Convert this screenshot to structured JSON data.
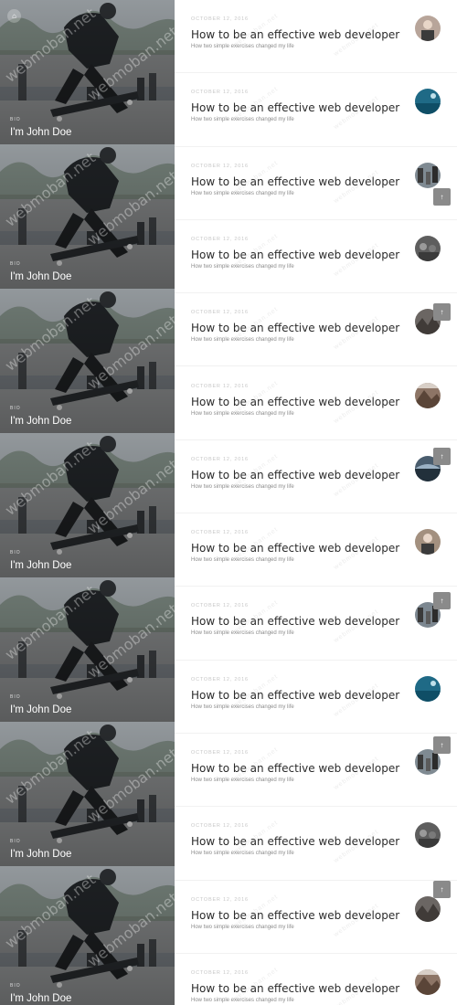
{
  "profile": {
    "bio_label": "BIO",
    "name": "I'm John Doe",
    "watermark": "webmoban.net",
    "home_icon": "home-icon"
  },
  "posts": [
    {
      "date": "OCTOBER 12, 2016",
      "title": "How to be an effective web developer",
      "excerpt": "How two simple exercises changed my life",
      "thumb": "person-photo",
      "thumb_color": "#b8a59a"
    },
    {
      "date": "OCTOBER 12, 2016",
      "title": "How to be an effective web developer",
      "excerpt": "How two simple exercises changed my life",
      "thumb": "ocean-photo",
      "thumb_color": "#1f6a86"
    },
    {
      "date": "OCTOBER 12, 2016",
      "title": "How to be an effective web developer",
      "excerpt": "How two simple exercises changed my life",
      "thumb": "street-photo",
      "thumb_color": "#7f8a92"
    },
    {
      "date": "OCTOBER 12, 2016",
      "title": "How to be an effective web developer",
      "excerpt": "How two simple exercises changed my life",
      "thumb": "crowd-photo",
      "thumb_color": "#5e5e5e"
    },
    {
      "date": "OCTOBER 12, 2016",
      "title": "How to be an effective web developer",
      "excerpt": "How two simple exercises changed my life",
      "thumb": "rocks-photo",
      "thumb_color": "#6b6663"
    },
    {
      "date": "OCTOBER 12, 2016",
      "title": "How to be an effective web developer",
      "excerpt": "How two simple exercises changed my life",
      "thumb": "mountain-photo",
      "thumb_color": "#8d7566"
    },
    {
      "date": "OCTOBER 12, 2016",
      "title": "How to be an effective web developer",
      "excerpt": "How two simple exercises changed my life",
      "thumb": "beach-photo",
      "thumb_color": "#4a5d6e"
    },
    {
      "date": "OCTOBER 12, 2016",
      "title": "How to be an effective web developer",
      "excerpt": "How two simple exercises changed my life",
      "thumb": "person-photo",
      "thumb_color": "#a3907f"
    },
    {
      "date": "OCTOBER 12, 2016",
      "title": "How to be an effective web developer",
      "excerpt": "How two simple exercises changed my life",
      "thumb": "street-photo",
      "thumb_color": "#7c8790"
    },
    {
      "date": "OCTOBER 12, 2016",
      "title": "How to be an effective web developer",
      "excerpt": "How two simple exercises changed my life",
      "thumb": "ocean-photo",
      "thumb_color": "#1f6a86"
    },
    {
      "date": "OCTOBER 12, 2016",
      "title": "How to be an effective web developer",
      "excerpt": "How two simple exercises changed my life",
      "thumb": "street-photo",
      "thumb_color": "#7f8a92"
    },
    {
      "date": "OCTOBER 12, 2016",
      "title": "How to be an effective web developer",
      "excerpt": "How two simple exercises changed my life",
      "thumb": "crowd-photo",
      "thumb_color": "#5e5e5e"
    },
    {
      "date": "OCTOBER 12, 2016",
      "title": "How to be an effective web developer",
      "excerpt": "How two simple exercises changed my life",
      "thumb": "rocks-photo",
      "thumb_color": "#6b6663"
    },
    {
      "date": "OCTOBER 12, 2016",
      "title": "How to be an effective web developer",
      "excerpt": "How two simple exercises changed my life",
      "thumb": "mountain-photo",
      "thumb_color": "#8d7566"
    }
  ],
  "back_to_top": {
    "icon": "arrow-up-icon",
    "glyph": "↑"
  },
  "colors": {
    "title": "#2b2b2b",
    "date": "#c7c7c7",
    "excerpt": "#8c8c8c",
    "button": "#8a8a8a"
  }
}
